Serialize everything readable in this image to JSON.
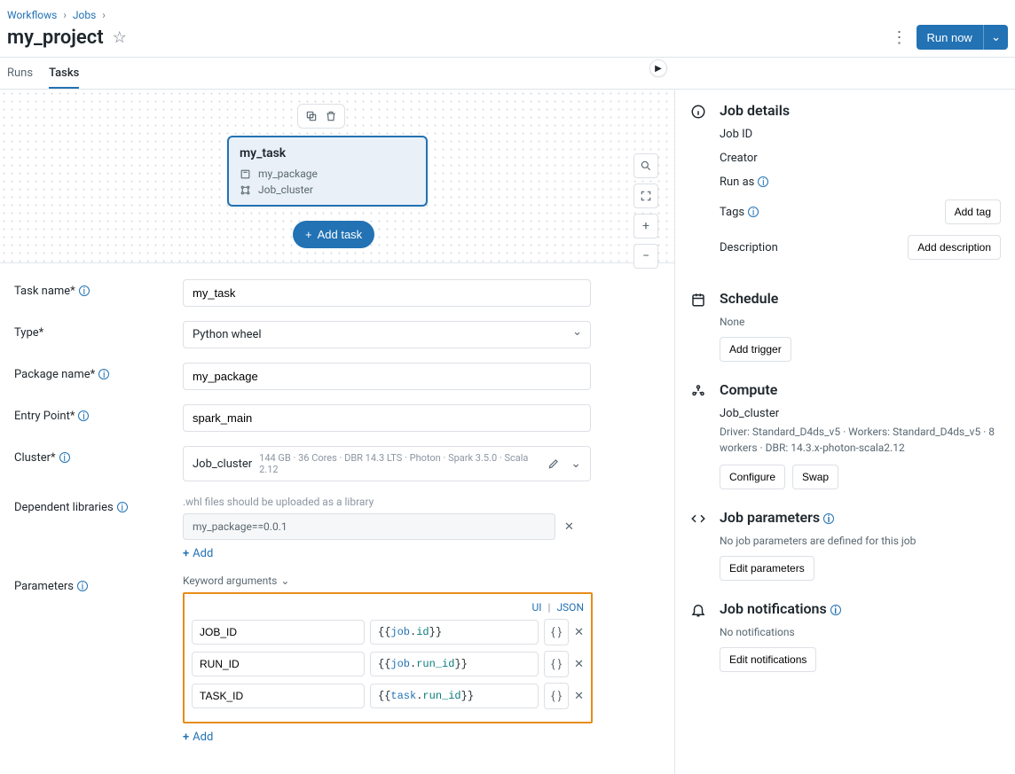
{
  "breadcrumb": {
    "workflows": "Workflows",
    "jobs": "Jobs"
  },
  "page_title": "my_project",
  "run_now": "Run now",
  "tabs": {
    "runs": "Runs",
    "tasks": "Tasks"
  },
  "task_card": {
    "name": "my_task",
    "package": "my_package",
    "cluster": "Job_cluster"
  },
  "add_task": "Add task",
  "form": {
    "task_name": {
      "label": "Task name*",
      "value": "my_task"
    },
    "type": {
      "label": "Type*",
      "value": "Python wheel"
    },
    "package_name": {
      "label": "Package name*",
      "value": "my_package"
    },
    "entry_point": {
      "label": "Entry Point*",
      "value": "spark_main"
    },
    "cluster": {
      "label": "Cluster*",
      "name": "Job_cluster",
      "spec": "144 GB · 36 Cores · DBR 14.3 LTS · Photon · Spark 3.5.0 · Scala 2.12"
    },
    "dep_libs": {
      "label": "Dependent libraries",
      "hint": ".whl files should be uploaded as a library",
      "value": "my_package==0.0.1",
      "add": "Add"
    },
    "parameters": {
      "label": "Parameters",
      "keyword_header": "Keyword arguments",
      "tabs": {
        "ui": "UI",
        "json": "JSON"
      },
      "rows": [
        {
          "key": "JOB_ID",
          "prefix": "job",
          "suffix": "id"
        },
        {
          "key": "RUN_ID",
          "prefix": "job",
          "suffix": "run_id"
        },
        {
          "key": "TASK_ID",
          "prefix": "task",
          "suffix": "run_id"
        }
      ],
      "add": "Add"
    }
  },
  "details": {
    "title": "Job details",
    "job_id": "Job ID",
    "creator": "Creator",
    "run_as": "Run as",
    "tags": "Tags",
    "add_tag": "Add tag",
    "description": "Description",
    "add_desc": "Add description"
  },
  "schedule": {
    "title": "Schedule",
    "none": "None",
    "add_trigger": "Add trigger"
  },
  "compute": {
    "title": "Compute",
    "cluster": "Job_cluster",
    "spec": "Driver: Standard_D4ds_v5 · Workers: Standard_D4ds_v5 · 8 workers · DBR: 14.3.x-photon-scala2.12",
    "configure": "Configure",
    "swap": "Swap"
  },
  "params": {
    "title": "Job parameters",
    "none": "No job parameters are defined for this job",
    "edit": "Edit parameters"
  },
  "notifs": {
    "title": "Job notifications",
    "none": "No notifications",
    "edit": "Edit notifications"
  }
}
